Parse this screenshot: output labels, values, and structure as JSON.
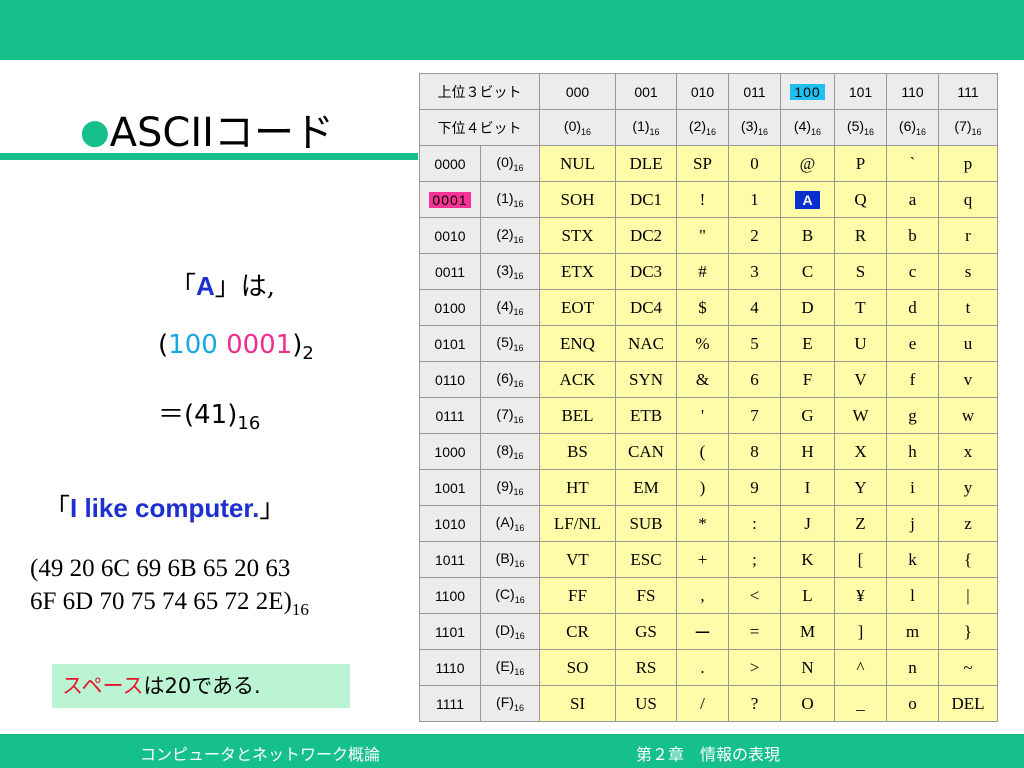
{
  "slide": {
    "title_bullet": "●",
    "title": "ASCIIコード",
    "explain_1_open": "「",
    "explain_1_letter": "A",
    "explain_1_close": "」は,",
    "explain_2_open": "(",
    "explain_2_upper": "100",
    "explain_2_lower": "0001",
    "explain_2_close": ")",
    "explain_2_sub": "2",
    "explain_3_main": "＝(41)",
    "explain_3_sub": "16",
    "explain_4_open": "「",
    "explain_4_text": "I like computer.",
    "explain_4_close": "」",
    "explain_5_line1": "(49 20 6C 69 6B 65 20 63",
    "explain_5_line2": "6F 6D 70 75 74 65 72 2E)",
    "explain_5_sub": "16",
    "note_red": "スペース",
    "note_rest": "は20である."
  },
  "footer": {
    "course": "コンピュータとネットワーク概論",
    "chapter": "第２章　情報の表現"
  },
  "table": {
    "upper_label": "上位３ビット",
    "lower_label": "下位４ビット",
    "columns": [
      {
        "bits": "000",
        "hex": "(0)"
      },
      {
        "bits": "001",
        "hex": "(1)"
      },
      {
        "bits": "010",
        "hex": "(2)"
      },
      {
        "bits": "011",
        "hex": "(3)"
      },
      {
        "bits": "100",
        "hex": "(4)"
      },
      {
        "bits": "101",
        "hex": "(5)"
      },
      {
        "bits": "110",
        "hex": "(6)"
      },
      {
        "bits": "111",
        "hex": "(7)"
      }
    ],
    "hex_sub": "16",
    "rows": [
      {
        "bits": "0000",
        "hex": "(0)",
        "cells": [
          "NUL",
          "DLE",
          "SP",
          "0",
          "@",
          "P",
          "`",
          "p"
        ]
      },
      {
        "bits": "0001",
        "hex": "(1)",
        "cells": [
          "SOH",
          "DC1",
          "!",
          "1",
          "A",
          "Q",
          "a",
          "q"
        ]
      },
      {
        "bits": "0010",
        "hex": "(2)",
        "cells": [
          "STX",
          "DC2",
          "\"",
          "2",
          "B",
          "R",
          "b",
          "r"
        ]
      },
      {
        "bits": "0011",
        "hex": "(3)",
        "cells": [
          "ETX",
          "DC3",
          "#",
          "3",
          "C",
          "S",
          "c",
          "s"
        ]
      },
      {
        "bits": "0100",
        "hex": "(4)",
        "cells": [
          "EOT",
          "DC4",
          "$",
          "4",
          "D",
          "T",
          "d",
          "t"
        ]
      },
      {
        "bits": "0101",
        "hex": "(5)",
        "cells": [
          "ENQ",
          "NAC",
          "%",
          "5",
          "E",
          "U",
          "e",
          "u"
        ]
      },
      {
        "bits": "0110",
        "hex": "(6)",
        "cells": [
          "ACK",
          "SYN",
          "&",
          "6",
          "F",
          "V",
          "f",
          "v"
        ]
      },
      {
        "bits": "0111",
        "hex": "(7)",
        "cells": [
          "BEL",
          "ETB",
          "'",
          "7",
          "G",
          "W",
          "g",
          "w"
        ]
      },
      {
        "bits": "1000",
        "hex": "(8)",
        "cells": [
          "BS",
          "CAN",
          "(",
          "8",
          "H",
          "X",
          "h",
          "x"
        ]
      },
      {
        "bits": "1001",
        "hex": "(9)",
        "cells": [
          "HT",
          "EM",
          ")",
          "9",
          "I",
          "Y",
          "i",
          "y"
        ]
      },
      {
        "bits": "1010",
        "hex": "(A)",
        "cells": [
          "LF/NL",
          "SUB",
          "*",
          ":",
          "J",
          "Z",
          "j",
          "z"
        ]
      },
      {
        "bits": "1011",
        "hex": "(B)",
        "cells": [
          "VT",
          "ESC",
          "+",
          ";",
          "K",
          "[",
          "k",
          "{"
        ]
      },
      {
        "bits": "1100",
        "hex": "(C)",
        "cells": [
          "FF",
          "FS",
          ",",
          "<",
          "L",
          "¥",
          "l",
          "|"
        ]
      },
      {
        "bits": "1101",
        "hex": "(D)",
        "cells": [
          "CR",
          "GS",
          "ー",
          "=",
          "M",
          "]",
          "m",
          "}"
        ]
      },
      {
        "bits": "1110",
        "hex": "(E)",
        "cells": [
          "SO",
          "RS",
          ".",
          ">",
          "N",
          "^",
          "n",
          "~"
        ]
      },
      {
        "bits": "1111",
        "hex": "(F)",
        "cells": [
          "SI",
          "US",
          "/",
          "?",
          "O",
          "_",
          "o",
          "DEL"
        ]
      }
    ],
    "highlight": {
      "column_index": 4,
      "row_index": 1
    }
  },
  "colors": {
    "accent_green": "#16c08a",
    "highlight_cyan": "#1fbff0",
    "highlight_pink": "#f73396",
    "highlight_blue": "#0a2fd0",
    "cell_yellow": "#fffca9",
    "header_gray": "#ececec",
    "note_bg": "#bbf4d2"
  }
}
